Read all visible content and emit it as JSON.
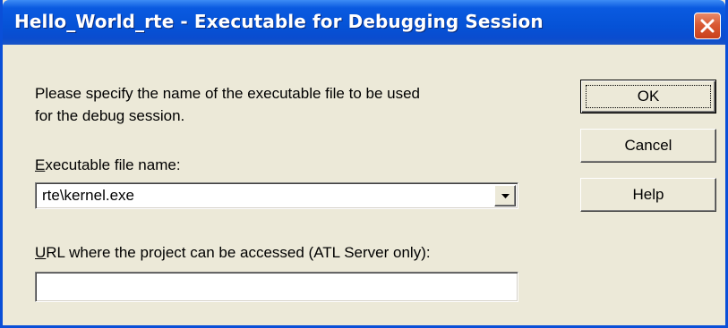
{
  "window": {
    "title": "Hello_World_rte - Executable for Debugging Session",
    "close_icon": "close-icon"
  },
  "dialog": {
    "instructions_line1": "Please specify the name of the executable file to be used",
    "instructions_line2": "for the debug session.",
    "exe_label_first": "E",
    "exe_label_rest": "xecutable file name:",
    "exe_value": "rte\\kernel.exe",
    "url_label_first": "U",
    "url_label_rest": "RL where the project can be accessed (ATL Server only):",
    "url_value": ""
  },
  "buttons": {
    "ok": "OK",
    "cancel": "Cancel",
    "help": "Help"
  },
  "colors": {
    "titlebar": "#0552d6",
    "dialog_bg": "#ece9d8",
    "close_button": "#d95a34"
  }
}
